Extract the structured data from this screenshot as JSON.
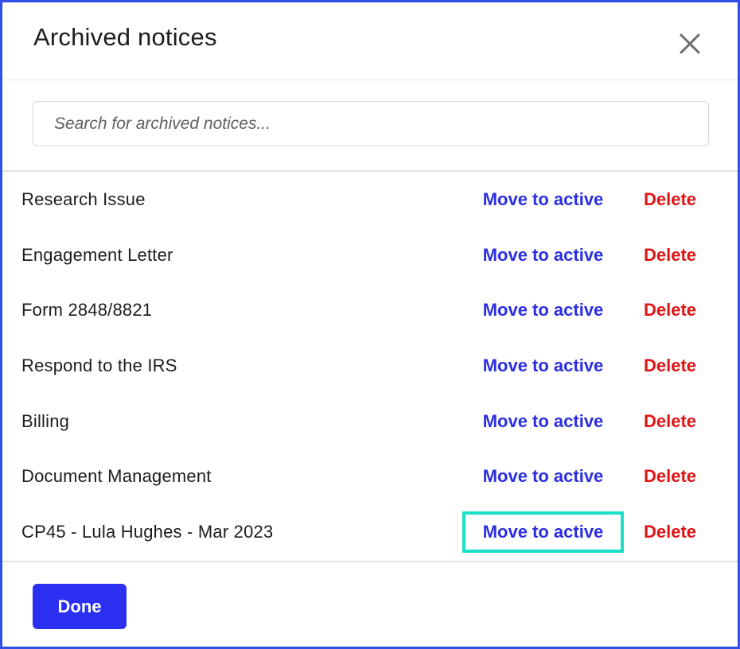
{
  "dialog": {
    "title": "Archived notices",
    "close_icon": "close-icon"
  },
  "search": {
    "placeholder": "Search for archived notices...",
    "value": ""
  },
  "notices": [
    {
      "name": "Research Issue",
      "move_label": "Move to active",
      "delete_label": "Delete"
    },
    {
      "name": "Engagement Letter",
      "move_label": "Move to active",
      "delete_label": "Delete"
    },
    {
      "name": "Form 2848/8821",
      "move_label": "Move to active",
      "delete_label": "Delete"
    },
    {
      "name": "Respond to the IRS",
      "move_label": "Move to active",
      "delete_label": "Delete"
    },
    {
      "name": "Billing",
      "move_label": "Move to active",
      "delete_label": "Delete"
    },
    {
      "name": "Document Management",
      "move_label": "Move to active",
      "delete_label": "Delete"
    },
    {
      "name": "CP45 - Lula Hughes - Mar 2023",
      "move_label": "Move to active",
      "delete_label": "Delete",
      "focused": true
    }
  ],
  "footer": {
    "done_label": "Done"
  },
  "colors": {
    "frame_border": "#2f4fe8",
    "action_blue": "#2b2fe0",
    "delete_red": "#e01414",
    "focus_ring": "#19e0c8",
    "done_button_bg": "#2b2ff0"
  }
}
